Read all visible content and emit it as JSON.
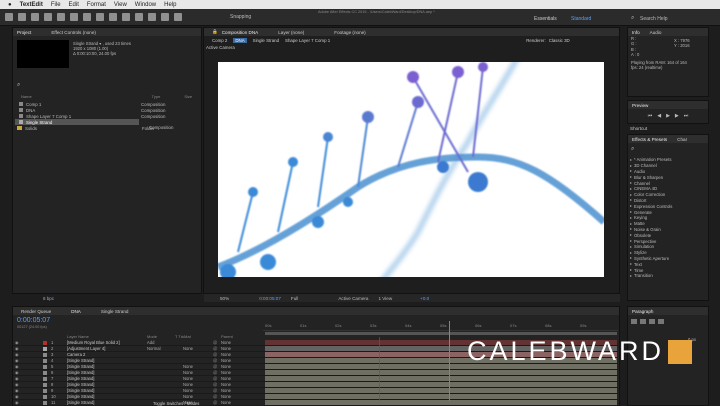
{
  "menubar": {
    "app": "TextEdit",
    "items": [
      "File",
      "Edit",
      "Format",
      "View",
      "Window",
      "Help"
    ],
    "window_title": "Adobe After Effects CC 2015 - /Users/CalebWard/Desktop/DNA.aep *"
  },
  "toolbar": {
    "snapping": "Snapping",
    "workspaces": [
      "Essentials",
      "Standard"
    ],
    "search_placeholder": "Search Help"
  },
  "project": {
    "tabs": [
      "Project",
      "Effect Controls (none)"
    ],
    "info_name": "Single Strand ▾ , used 23 times",
    "info_size": "1920 x 1080 (1.00)",
    "info_duration": "Δ 0:00:10:00, 24.00 fps",
    "columns": [
      "Name",
      "Type",
      "Size"
    ],
    "items": [
      {
        "name": "Comp 1",
        "type": "Composition"
      },
      {
        "name": "DNA",
        "type": "Composition"
      },
      {
        "name": "Shape Layer 7 Comp 1",
        "type": "Composition"
      },
      {
        "name": "Single Strand",
        "type": "Composition"
      },
      {
        "name": "Solids",
        "type": "Folder"
      }
    ],
    "bpc": "8 bpc"
  },
  "composition": {
    "tabs": [
      "Composition DNA",
      "Layer (none)",
      "Footage (none)"
    ],
    "flow": [
      "Comp 2",
      "DNA",
      "Single Strand",
      "Shape Layer 7 Comp 1"
    ],
    "renderer": "Renderer:",
    "renderer_value": "Classic 3D",
    "active_camera_label": "Active Camera",
    "zoom": "50%",
    "timecode": "0:00:05:07",
    "resolution": "Full",
    "camera": "Active Camera",
    "views": "1 View",
    "exposure": "+0.0"
  },
  "info": {
    "tabs": [
      "Info",
      "Audio"
    ],
    "r": "R :",
    "g": "G :",
    "b": "B :",
    "a": "A : 0",
    "x": "X : 7976",
    "y": "Y : 2016",
    "playing": "Playing from RAM: 164 of 164",
    "fps": "fps: 24 (realtime)"
  },
  "preview": {
    "title": "Preview"
  },
  "shortcut": {
    "title": "Shortcut"
  },
  "effects": {
    "tabs": [
      "Effects & Presets",
      "Char"
    ],
    "items": [
      "* Animation Presets",
      "3D Channel",
      "Audio",
      "Blur & Sharpen",
      "Channel",
      "CINEMA 4D",
      "Color Correction",
      "Distort",
      "Expression Controls",
      "Generate",
      "Keying",
      "Matte",
      "Noise & Grain",
      "Obsolete",
      "Perspective",
      "Simulation",
      "Stylize",
      "Synthetic Aperture",
      "Text",
      "Time",
      "Transition"
    ]
  },
  "paragraph": {
    "title": "Paragraph",
    "value": "0 px"
  },
  "timeline": {
    "tabs": [
      "Render Queue",
      "DNA",
      "Single Strand"
    ],
    "timecode": "0:00:05:07",
    "frames": "00127 (24.00 fps)",
    "columns": [
      "Layer Name",
      "Mode",
      "T TrkMat",
      "Parent"
    ],
    "footer": "Toggle Switches / Modes",
    "ruler": [
      "00s",
      "01s",
      "02s",
      "03s",
      "04s",
      "05s",
      "06s",
      "07s",
      "08s",
      "09s"
    ],
    "layers": [
      {
        "num": "1",
        "name": "[Medium Royal Blue Solid 2]",
        "mode": "Add",
        "trkmat": "",
        "parent": "None",
        "color": "#b03030"
      },
      {
        "num": "2",
        "name": "[Adjustment Layer 4]",
        "mode": "Normal",
        "trkmat": "None",
        "parent": "None",
        "color": "#a8a8a8"
      },
      {
        "num": "3",
        "name": "Camera 2",
        "mode": "",
        "trkmat": "",
        "parent": "None",
        "color": "#8a8a8a"
      },
      {
        "num": "4",
        "name": "[Single Strand]",
        "mode": "",
        "trkmat": "",
        "parent": "None",
        "color": "#8a8a8a"
      },
      {
        "num": "5",
        "name": "[Single Strand]",
        "mode": "",
        "trkmat": "None",
        "parent": "None",
        "color": "#8a8a8a"
      },
      {
        "num": "6",
        "name": "[Single Strand]",
        "mode": "",
        "trkmat": "None",
        "parent": "None",
        "color": "#8a8a8a"
      },
      {
        "num": "7",
        "name": "[Single Strand]",
        "mode": "",
        "trkmat": "None",
        "parent": "None",
        "color": "#8a8a8a"
      },
      {
        "num": "8",
        "name": "[Single Strand]",
        "mode": "",
        "trkmat": "None",
        "parent": "None",
        "color": "#8a8a8a"
      },
      {
        "num": "9",
        "name": "[Single Strand]",
        "mode": "",
        "trkmat": "None",
        "parent": "None",
        "color": "#8a8a8a"
      },
      {
        "num": "10",
        "name": "[Single Strand]",
        "mode": "",
        "trkmat": "None",
        "parent": "None",
        "color": "#8a8a8a"
      },
      {
        "num": "11",
        "name": "[Single Strand]",
        "mode": "",
        "trkmat": "None",
        "parent": "None",
        "color": "#8a8a8a"
      }
    ]
  },
  "watermark": {
    "text": "CALEBWARD"
  }
}
